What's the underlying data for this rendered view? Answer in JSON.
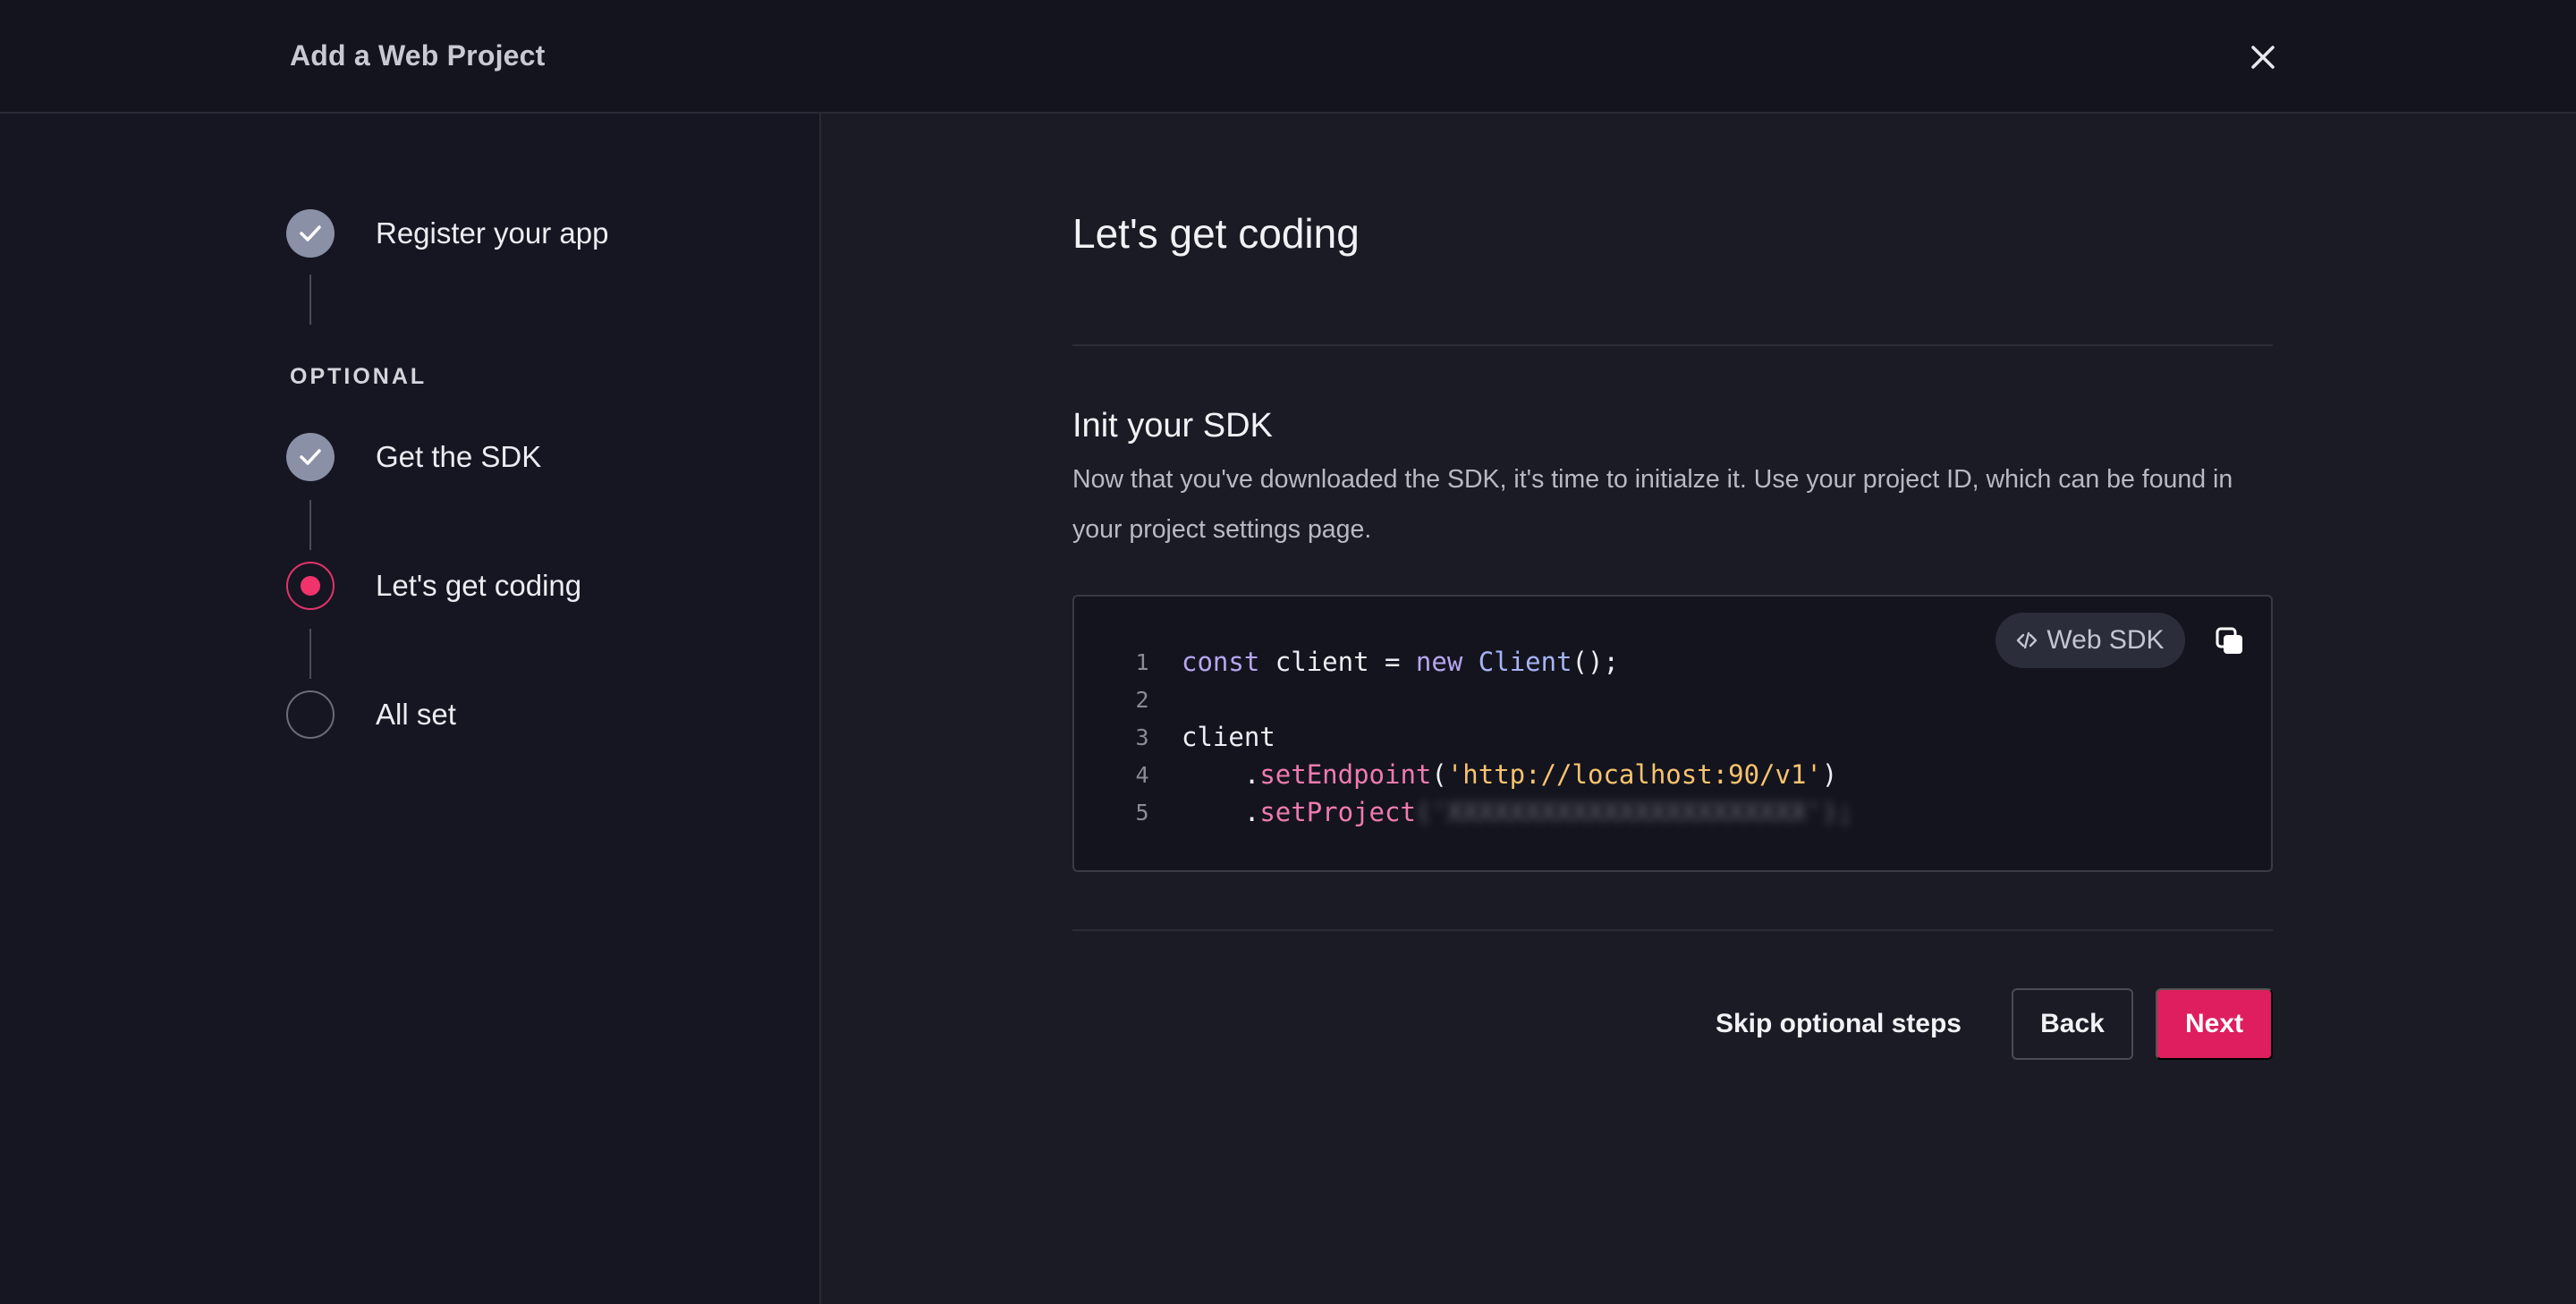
{
  "header": {
    "title": "Add a Web Project",
    "close_icon": "close-icon"
  },
  "sidebar": {
    "optional_label": "OPTIONAL",
    "steps": [
      {
        "label": "Register your app",
        "state": "done"
      },
      {
        "label": "Get the SDK",
        "state": "done"
      },
      {
        "label": "Let's get coding",
        "state": "current"
      },
      {
        "label": "All set",
        "state": "pending"
      }
    ]
  },
  "main": {
    "title": "Let's get coding",
    "section_title": "Init your SDK",
    "section_desc": "Now that you've downloaded the SDK, it's time to initialze it. Use your project ID, which can be found in your project settings page.",
    "code": {
      "badge_label": "Web SDK",
      "lines": [
        {
          "num": "1"
        },
        {
          "num": "2"
        },
        {
          "num": "3"
        },
        {
          "num": "4"
        },
        {
          "num": "5"
        }
      ],
      "tokens": {
        "const": "const",
        "client_decl": " client = ",
        "new": "new",
        "space": " ",
        "Client": "Client",
        "call_end": "();",
        "client": "client",
        "indent": "    .",
        "setEndpoint": "setEndpoint",
        "paren_open": "(",
        "endpoint_url": "'http://localhost:90/v1'",
        "paren_close": ")",
        "setProject": "setProject",
        "project_id_hidden": "('XXXXXXXXXXXXXXXXXXXXXXX');"
      }
    },
    "actions": {
      "skip_label": "Skip optional steps",
      "back_label": "Back",
      "next_label": "Next"
    }
  },
  "colors": {
    "accent": "#de1e5e",
    "step_done": "#8a90a6",
    "background": "#1b1b25",
    "sidebar": "#161622"
  }
}
